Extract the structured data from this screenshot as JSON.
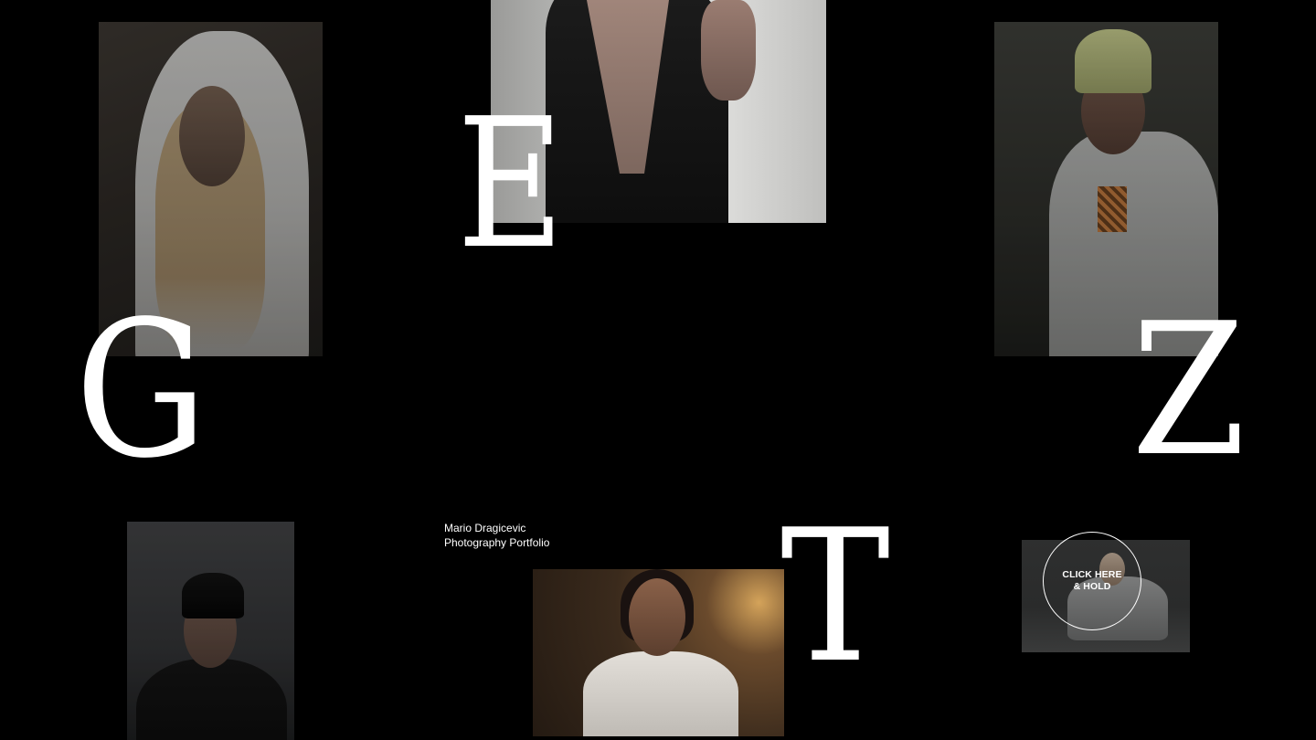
{
  "letters": {
    "e": "E",
    "g": "G",
    "z": "Z",
    "t": "T"
  },
  "caption": {
    "name": "Mario Dragicevic",
    "subtitle": "Photography Portfolio"
  },
  "hold_button": {
    "line1": "CLICK HERE",
    "line2": "& HOLD"
  },
  "colors": {
    "background": "#000000",
    "text": "#ffffff"
  }
}
